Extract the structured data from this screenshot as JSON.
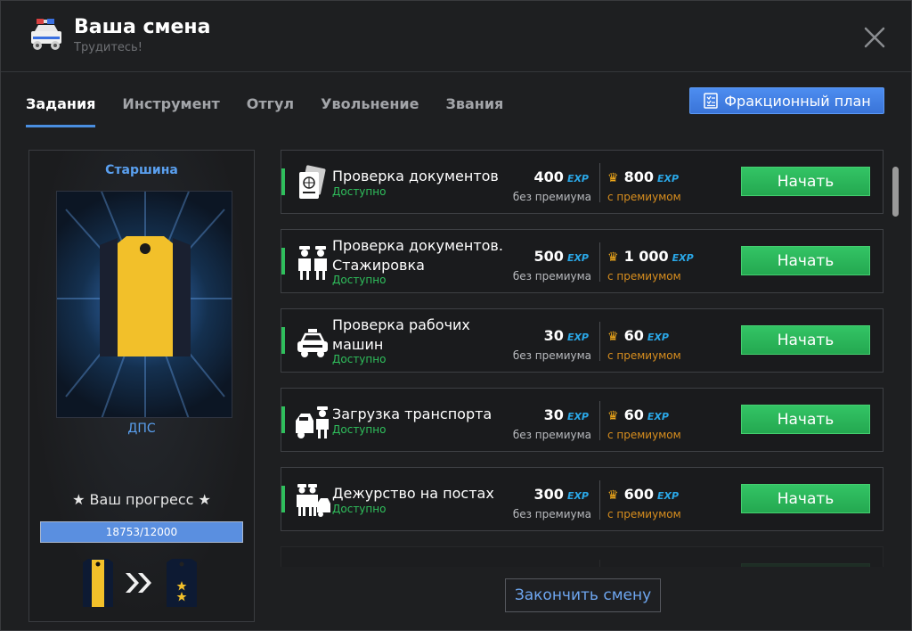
{
  "window": {
    "title": "Ваша смена",
    "subtitle": "Трудитесь!",
    "icon": "police-car-icon",
    "close_icon": "close-icon"
  },
  "tabs": [
    {
      "label": "Задания",
      "active": true
    },
    {
      "label": "Инструмент",
      "active": false
    },
    {
      "label": "Отгул",
      "active": false
    },
    {
      "label": "Увольнение",
      "active": false
    },
    {
      "label": "Звания",
      "active": false
    }
  ],
  "faction_button": {
    "label": "Фракционный план",
    "icon": "checklist-icon"
  },
  "rank": {
    "name": "Старшина",
    "department": "ДПС",
    "progress_label": "★ Ваш прогресс ★",
    "progress_text": "18753/12000",
    "progress_fraction": 1.0
  },
  "tasks": [
    {
      "name": "Проверка документов",
      "status": "Доступно",
      "exp": "400",
      "exp_premium": "800",
      "icon": "passport-icon"
    },
    {
      "name": "Проверка документов. Стажировка",
      "status": "Доступно",
      "exp": "500",
      "exp_premium": "1 000",
      "icon": "officers-icon"
    },
    {
      "name": "Проверка рабочих машин",
      "status": "Доступно",
      "exp": "30",
      "exp_premium": "60",
      "icon": "police-car-icon"
    },
    {
      "name": "Загрузка транспорта",
      "status": "Доступно",
      "exp": "30",
      "exp_premium": "60",
      "icon": "tow-truck-officer-icon"
    },
    {
      "name": "Дежурство на постах",
      "status": "Доступно",
      "exp": "300",
      "exp_premium": "600",
      "icon": "officers-car-icon"
    }
  ],
  "task_labels": {
    "exp_tag": "EXP",
    "without_premium": "без премиума",
    "with_premium": "с премиумом",
    "start": "Начать"
  },
  "finish_button": "Закончить смену",
  "colors": {
    "accent_blue": "#4a8ee0",
    "start_green": "#2fbf5c",
    "premium_orange": "#d88e1e",
    "exp_cyan": "#2aa8e8"
  }
}
